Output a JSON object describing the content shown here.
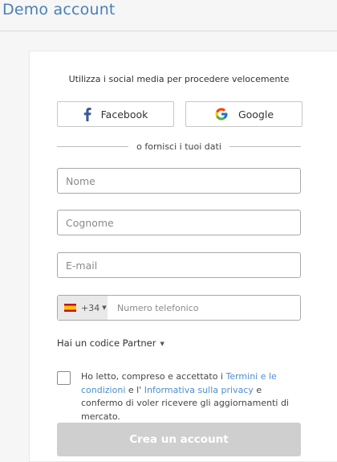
{
  "header": {
    "title": "Demo account"
  },
  "social": {
    "title": "Utilizza i social media per procedere velocemente",
    "facebook_label": "Facebook",
    "google_label": "Google",
    "divider_text": "o fornisci i tuoi dati"
  },
  "form": {
    "first_name_placeholder": "Nome",
    "last_name_placeholder": "Cognome",
    "email_placeholder": "E-mail",
    "phone": {
      "country_flag": "spain-flag-icon",
      "country_code": "+34",
      "placeholder": "Numero telefonico"
    },
    "partner_label": "Hai un codice Partner",
    "consent": {
      "checked": false,
      "text_1": "Ho letto, compreso e accettato i ",
      "link_terms": "Termini e le condizioni",
      "text_2": " e l' ",
      "link_privacy": "Informativa sulla privacy",
      "text_3": " e confermo di voler ricevere gli aggiornamenti di mercato."
    },
    "submit_label": "Crea un account"
  },
  "colors": {
    "title_blue": "#4a7fb8",
    "link_blue": "#4a8fd0",
    "facebook_blue": "#3b5998",
    "button_disabled": "#cfcfcf"
  }
}
